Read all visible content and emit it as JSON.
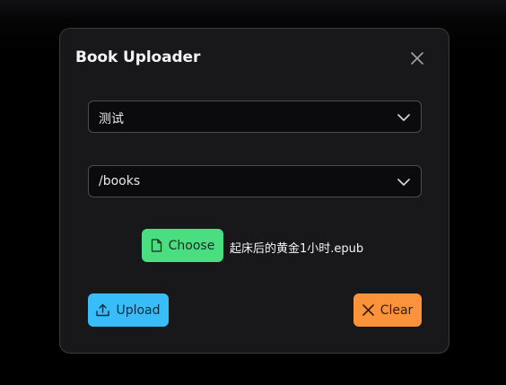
{
  "dialog": {
    "title": "Book Uploader"
  },
  "library_select": {
    "value": "测试"
  },
  "path_select": {
    "value": "/books"
  },
  "file_picker": {
    "choose_label": "Choose",
    "selected_file": "起床后的黄金1小时.epub"
  },
  "actions": {
    "upload_label": "Upload",
    "clear_label": "Clear"
  },
  "colors": {
    "choose": "#4ade80",
    "upload": "#38bdf8",
    "clear": "#fb923c",
    "dialog_bg": "#18181b"
  },
  "icons": {
    "close": "close-icon",
    "chevron": "chevron-down-icon",
    "file": "file-icon",
    "upload": "upload-icon",
    "clear": "x-icon"
  }
}
